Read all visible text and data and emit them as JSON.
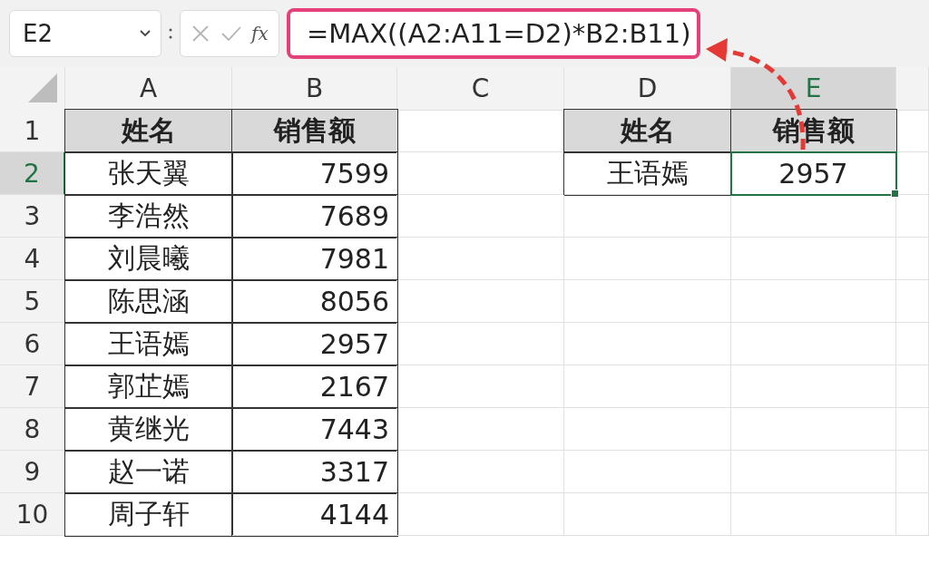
{
  "name_box": {
    "value": "E2"
  },
  "formula_bar": {
    "fx_label": "fx",
    "value": "=MAX((A2:A11=D2)*B2:B11)"
  },
  "columns": [
    {
      "label": "A",
      "selected": false
    },
    {
      "label": "B",
      "selected": false
    },
    {
      "label": "C",
      "selected": false
    },
    {
      "label": "D",
      "selected": false
    },
    {
      "label": "E",
      "selected": true
    }
  ],
  "rows": [
    {
      "number": "1",
      "selected": false,
      "cells": [
        {
          "kind": "header",
          "text": "姓名",
          "selected": false
        },
        {
          "kind": "header",
          "text": "销售额",
          "selected": false
        },
        {
          "kind": "empty",
          "selected": false
        },
        {
          "kind": "header",
          "text": "姓名",
          "selected": false
        },
        {
          "kind": "header",
          "text": "销售额",
          "selected": false
        }
      ]
    },
    {
      "number": "2",
      "selected": true,
      "cells": [
        {
          "kind": "text",
          "text": "张天翼",
          "selected": false
        },
        {
          "kind": "number",
          "text": "7599",
          "selected": false
        },
        {
          "kind": "empty",
          "selected": false
        },
        {
          "kind": "text",
          "text": "王语嫣",
          "selected": false
        },
        {
          "kind": "result",
          "text": "2957",
          "selected": true
        }
      ]
    },
    {
      "number": "3",
      "selected": false,
      "cells": [
        {
          "kind": "text",
          "text": "李浩然",
          "selected": false
        },
        {
          "kind": "number",
          "text": "7689",
          "selected": false
        },
        {
          "kind": "empty",
          "selected": false
        },
        {
          "kind": "empty",
          "selected": false
        },
        {
          "kind": "empty",
          "selected": false
        }
      ]
    },
    {
      "number": "4",
      "selected": false,
      "cells": [
        {
          "kind": "text",
          "text": "刘晨曦",
          "selected": false
        },
        {
          "kind": "number",
          "text": "7981",
          "selected": false
        },
        {
          "kind": "empty",
          "selected": false
        },
        {
          "kind": "empty",
          "selected": false
        },
        {
          "kind": "empty",
          "selected": false
        }
      ]
    },
    {
      "number": "5",
      "selected": false,
      "cells": [
        {
          "kind": "text",
          "text": "陈思涵",
          "selected": false
        },
        {
          "kind": "number",
          "text": "8056",
          "selected": false
        },
        {
          "kind": "empty",
          "selected": false
        },
        {
          "kind": "empty",
          "selected": false
        },
        {
          "kind": "empty",
          "selected": false
        }
      ]
    },
    {
      "number": "6",
      "selected": false,
      "cells": [
        {
          "kind": "text",
          "text": "王语嫣",
          "selected": false
        },
        {
          "kind": "number",
          "text": "2957",
          "selected": false
        },
        {
          "kind": "empty",
          "selected": false
        },
        {
          "kind": "empty",
          "selected": false
        },
        {
          "kind": "empty",
          "selected": false
        }
      ]
    },
    {
      "number": "7",
      "selected": false,
      "cells": [
        {
          "kind": "text",
          "text": "郭芷嫣",
          "selected": false
        },
        {
          "kind": "number",
          "text": "2167",
          "selected": false
        },
        {
          "kind": "empty",
          "selected": false
        },
        {
          "kind": "empty",
          "selected": false
        },
        {
          "kind": "empty",
          "selected": false
        }
      ]
    },
    {
      "number": "8",
      "selected": false,
      "cells": [
        {
          "kind": "text",
          "text": "黄继光",
          "selected": false
        },
        {
          "kind": "number",
          "text": "7443",
          "selected": false
        },
        {
          "kind": "empty",
          "selected": false
        },
        {
          "kind": "empty",
          "selected": false
        },
        {
          "kind": "empty",
          "selected": false
        }
      ]
    },
    {
      "number": "9",
      "selected": false,
      "cells": [
        {
          "kind": "text",
          "text": "赵一诺",
          "selected": false
        },
        {
          "kind": "number",
          "text": "3317",
          "selected": false
        },
        {
          "kind": "empty",
          "selected": false
        },
        {
          "kind": "empty",
          "selected": false
        },
        {
          "kind": "empty",
          "selected": false
        }
      ]
    },
    {
      "number": "10",
      "selected": false,
      "cells": [
        {
          "kind": "text",
          "text": "周子轩",
          "selected": false
        },
        {
          "kind": "number",
          "text": "4144",
          "selected": false
        },
        {
          "kind": "empty",
          "selected": false
        },
        {
          "kind": "empty",
          "selected": false
        },
        {
          "kind": "empty",
          "selected": false
        }
      ]
    }
  ]
}
